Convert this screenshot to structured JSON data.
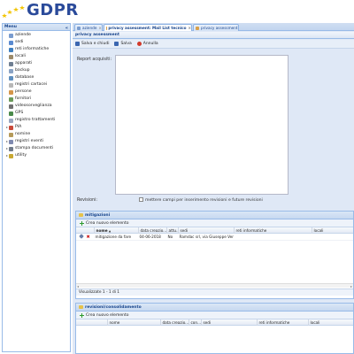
{
  "app": {
    "logo_text": "GDPR"
  },
  "sidebar": {
    "title": "Menu",
    "collapse_glyph": "«",
    "items": [
      {
        "label": "aziende",
        "icon": "building-icon",
        "color": "#7a9ccf",
        "expandable": false
      },
      {
        "label": "sedi",
        "icon": "location-icon",
        "color": "#5a8ad0",
        "expandable": false
      },
      {
        "label": "reti informatiche",
        "icon": "network-icon",
        "color": "#3f7fbf",
        "expandable": false
      },
      {
        "label": "locali",
        "icon": "room-icon",
        "color": "#9c8a6a",
        "expandable": false
      },
      {
        "label": "apparati",
        "icon": "device-icon",
        "color": "#6f7f92",
        "expandable": false
      },
      {
        "label": "backup",
        "icon": "backup-icon",
        "color": "#8aa3c4",
        "expandable": false
      },
      {
        "label": "database",
        "icon": "database-icon",
        "color": "#5f8fbf",
        "expandable": false
      },
      {
        "label": "registri cartacei",
        "icon": "paper-register-icon",
        "color": "#b7b7b7",
        "expandable": false
      },
      {
        "label": "persone",
        "icon": "person-icon",
        "color": "#d4964b",
        "expandable": false
      },
      {
        "label": "fornitori",
        "icon": "supplier-icon",
        "color": "#6a9a5a",
        "expandable": false
      },
      {
        "label": "videosorveglianza",
        "icon": "camera-icon",
        "color": "#707070",
        "expandable": false
      },
      {
        "label": "GPS",
        "icon": "gps-icon",
        "color": "#4a8a4a",
        "expandable": false
      },
      {
        "label": "registro trattamenti",
        "icon": "register-icon",
        "color": "#9aa7c0",
        "expandable": false
      },
      {
        "label": "PIA",
        "icon": "pia-icon",
        "color": "#c94a3a",
        "expandable": true
      },
      {
        "label": "nomine",
        "icon": "appointment-icon",
        "color": "#b59a5a",
        "expandable": false
      },
      {
        "label": "registri eventi",
        "icon": "events-icon",
        "color": "#7f8ab0",
        "expandable": true
      },
      {
        "label": "stampa documenti",
        "icon": "print-icon",
        "color": "#6f7a8a",
        "expandable": true
      },
      {
        "label": "utility",
        "icon": "utility-icon",
        "color": "#c8a832",
        "expandable": true
      }
    ]
  },
  "tabs": [
    {
      "label": "aziende",
      "active": false
    },
    {
      "label": "privacy assessment: Mail List tecnico",
      "active": true
    },
    {
      "label": "privacy assessment",
      "active": false
    }
  ],
  "main": {
    "subtitle": "privacy assessment",
    "toolbar": {
      "save_close": "Salva e chiudi",
      "save": "Salva",
      "cancel": "Annulla"
    },
    "form": {
      "report_label": "Report acquisiti:",
      "revisioni_label": "Revisioni:",
      "revisioni_checkbox_label": "mettere campi per inserimento revisioni e future revisioni"
    }
  },
  "mitigazioni": {
    "title": "mitigazioni",
    "new_button": "Crea nuovo elemento",
    "columns": [
      "nome",
      "data creazio...",
      "attu...",
      "sedi",
      "reti informatiche",
      "locali"
    ],
    "sort_glyph": "▲",
    "rows": [
      {
        "nome": "mitigazione da fare",
        "data": "04-06-2018",
        "attu": "No",
        "sedi": "Ramdac srl, via Giuseppe Ver...",
        "reti": "",
        "locali": ""
      }
    ],
    "footer": "Visualizzate 1 - 1 di 1"
  },
  "revisioni": {
    "title": "revisioni/consolidamento",
    "new_button": "Crea nuovo elemento",
    "columns": [
      "nome",
      "data creazio...",
      "con...",
      "sedi",
      "reti informatiche",
      "locali"
    ]
  }
}
